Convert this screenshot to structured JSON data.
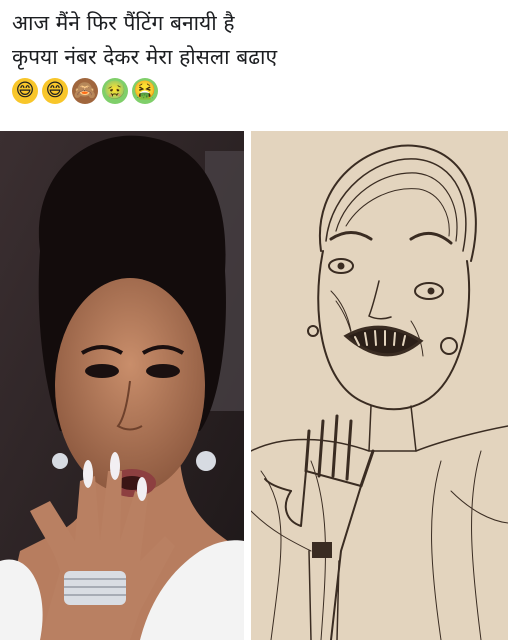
{
  "post": {
    "caption_line_1": "आज मैंने फिर पैंटिंग बनायी है",
    "caption_line_2": "कृपया नंबर देकर मेरा होसला बढाए",
    "emojis": [
      {
        "name": "grinning-face-icon",
        "glyph": "😄"
      },
      {
        "name": "grinning-face-icon",
        "glyph": "😄"
      },
      {
        "name": "see-no-evil-monkey-icon",
        "glyph": "🙈"
      },
      {
        "name": "nauseated-face-icon",
        "glyph": "🤢"
      },
      {
        "name": "vomiting-face-icon",
        "glyph": "🤮"
      }
    ]
  },
  "colors": {
    "caption_text": "#1c1e21",
    "photo_bg": "#2a2223",
    "paper": "#e2d2bb",
    "ink": "#3a2c22"
  }
}
